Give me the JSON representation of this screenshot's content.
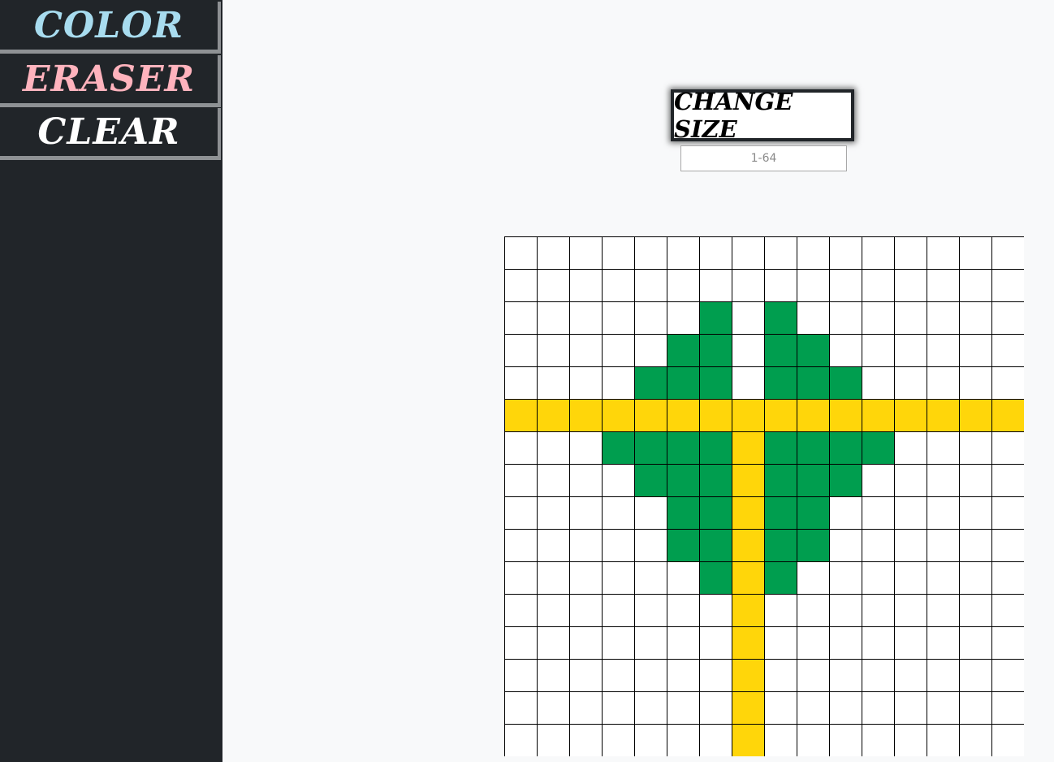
{
  "sidebar": {
    "buttons": [
      {
        "label": "COLOR",
        "color": "#a8dcef"
      },
      {
        "label": "ERASER",
        "color": "#ffb3bd"
      },
      {
        "label": "CLEAR",
        "color": "#ffffff"
      }
    ]
  },
  "controls": {
    "change_size_label": "CHANGE SIZE",
    "size_input_placeholder": "1-64",
    "size_input_value": ""
  },
  "grid": {
    "rows": 16,
    "cols": 16,
    "palette": {
      "W": "#ffffff",
      "G": "#009e4f",
      "Y": "#ffd60a"
    },
    "pixels": [
      "WWWWWWWWWWWWWWWW",
      "WWWWWWWWWWWWWWWW",
      "WWWWWWGWGWWWWWWW",
      "WWWWWGGWGGWWWWWW",
      "WWWWGGGWGGGWWWWW",
      "YYYYYYYYYYYYYYYY",
      "WWWGGGGYGGGGWWWW",
      "WWWWGGGYGGGWWWWW",
      "WWWWWGGYGGWWWWWW",
      "WWWWWGGYGGWWWWWW",
      "WWWWWWGYGWWWWWWW",
      "WWWWWWWYWWWWWWWW",
      "WWWWWWWYWWWWWWWW",
      "WWWWWWWYWWWWWWWW",
      "WWWWWWWYWWWWWWWW",
      "WWWWWWWYWWWWWWWW"
    ]
  }
}
